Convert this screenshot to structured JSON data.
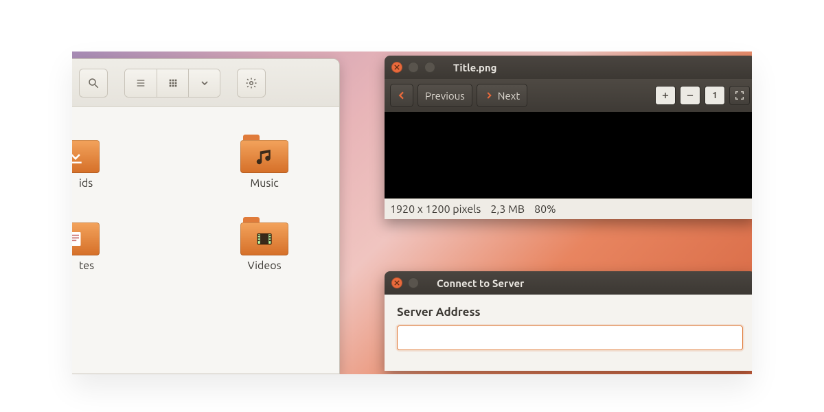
{
  "file_manager": {
    "toolbar": {
      "search_icon": "search",
      "view_list_icon": "list",
      "view_grid_icon": "grid",
      "view_menu_icon": "chevron-down",
      "settings_icon": "gear"
    },
    "folders": [
      {
        "label_fragment": "ids",
        "icon": "download"
      },
      {
        "label": "Music",
        "icon": "music"
      },
      {
        "label_fragment": "tes",
        "icon": "template"
      },
      {
        "label": "Videos",
        "icon": "video"
      }
    ]
  },
  "image_viewer": {
    "title": "Title.png",
    "nav": {
      "previous_label": "Previous",
      "next_label": "Next"
    },
    "tools": {
      "zoom_in_icon": "plus",
      "zoom_out_icon": "minus",
      "normal_size_icon": "one",
      "fit_icon": "fit"
    },
    "status": {
      "dimensions": "1920 x 1200 pixels",
      "filesize": "2,3 MB",
      "zoom": "80%"
    }
  },
  "connect_server": {
    "title": "Connect to Server",
    "address_label": "Server Address",
    "address_value": ""
  },
  "colors": {
    "accent": "#e07b3a",
    "window_chrome": "#3e3a35"
  }
}
